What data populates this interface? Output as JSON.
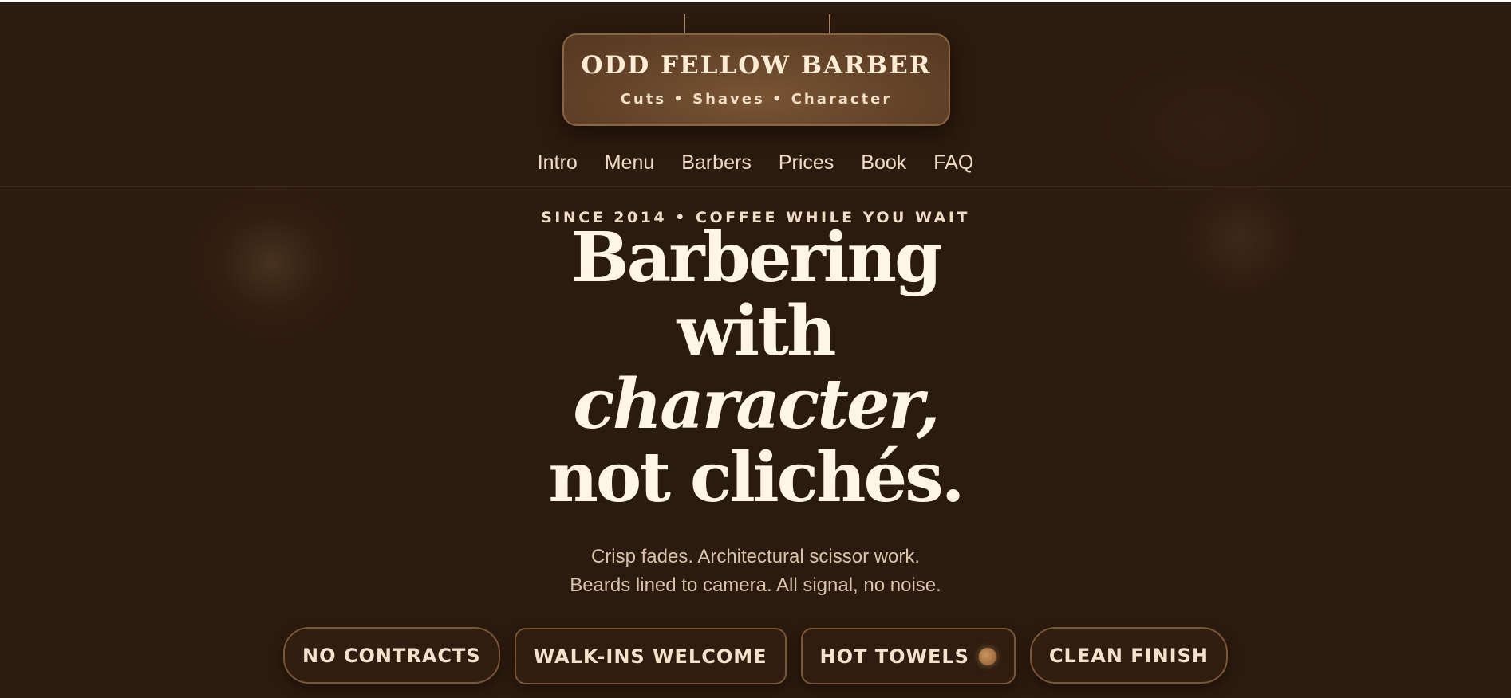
{
  "brand": {
    "name": "ODD FELLOW BARBER",
    "tagline": "Cuts • Shaves • Character"
  },
  "nav": {
    "items": [
      {
        "label": "Intro"
      },
      {
        "label": "Menu"
      },
      {
        "label": "Barbers"
      },
      {
        "label": "Prices"
      },
      {
        "label": "Book"
      },
      {
        "label": "FAQ"
      }
    ]
  },
  "hero": {
    "eyebrow": "SINCE 2014 • COFFEE WHILE YOU WAIT",
    "headline": {
      "line1": "Barbering",
      "line2": "with",
      "line3": "character,",
      "line4": "not clichés."
    },
    "subtext": {
      "line1": "Crisp fades. Architectural scissor work.",
      "line2": "Beards lined to camera. All signal, no noise."
    },
    "chips": [
      {
        "label": "NO CONTRACTS"
      },
      {
        "label": "WALK-INS WELCOME"
      },
      {
        "label": "HOT TOWELS"
      },
      {
        "label": "CLEAN FINISH"
      }
    ]
  },
  "colors": {
    "background": "#2b1a0e",
    "sign": "#644328",
    "text": "#fff5e6",
    "accent": "#c9955f"
  }
}
